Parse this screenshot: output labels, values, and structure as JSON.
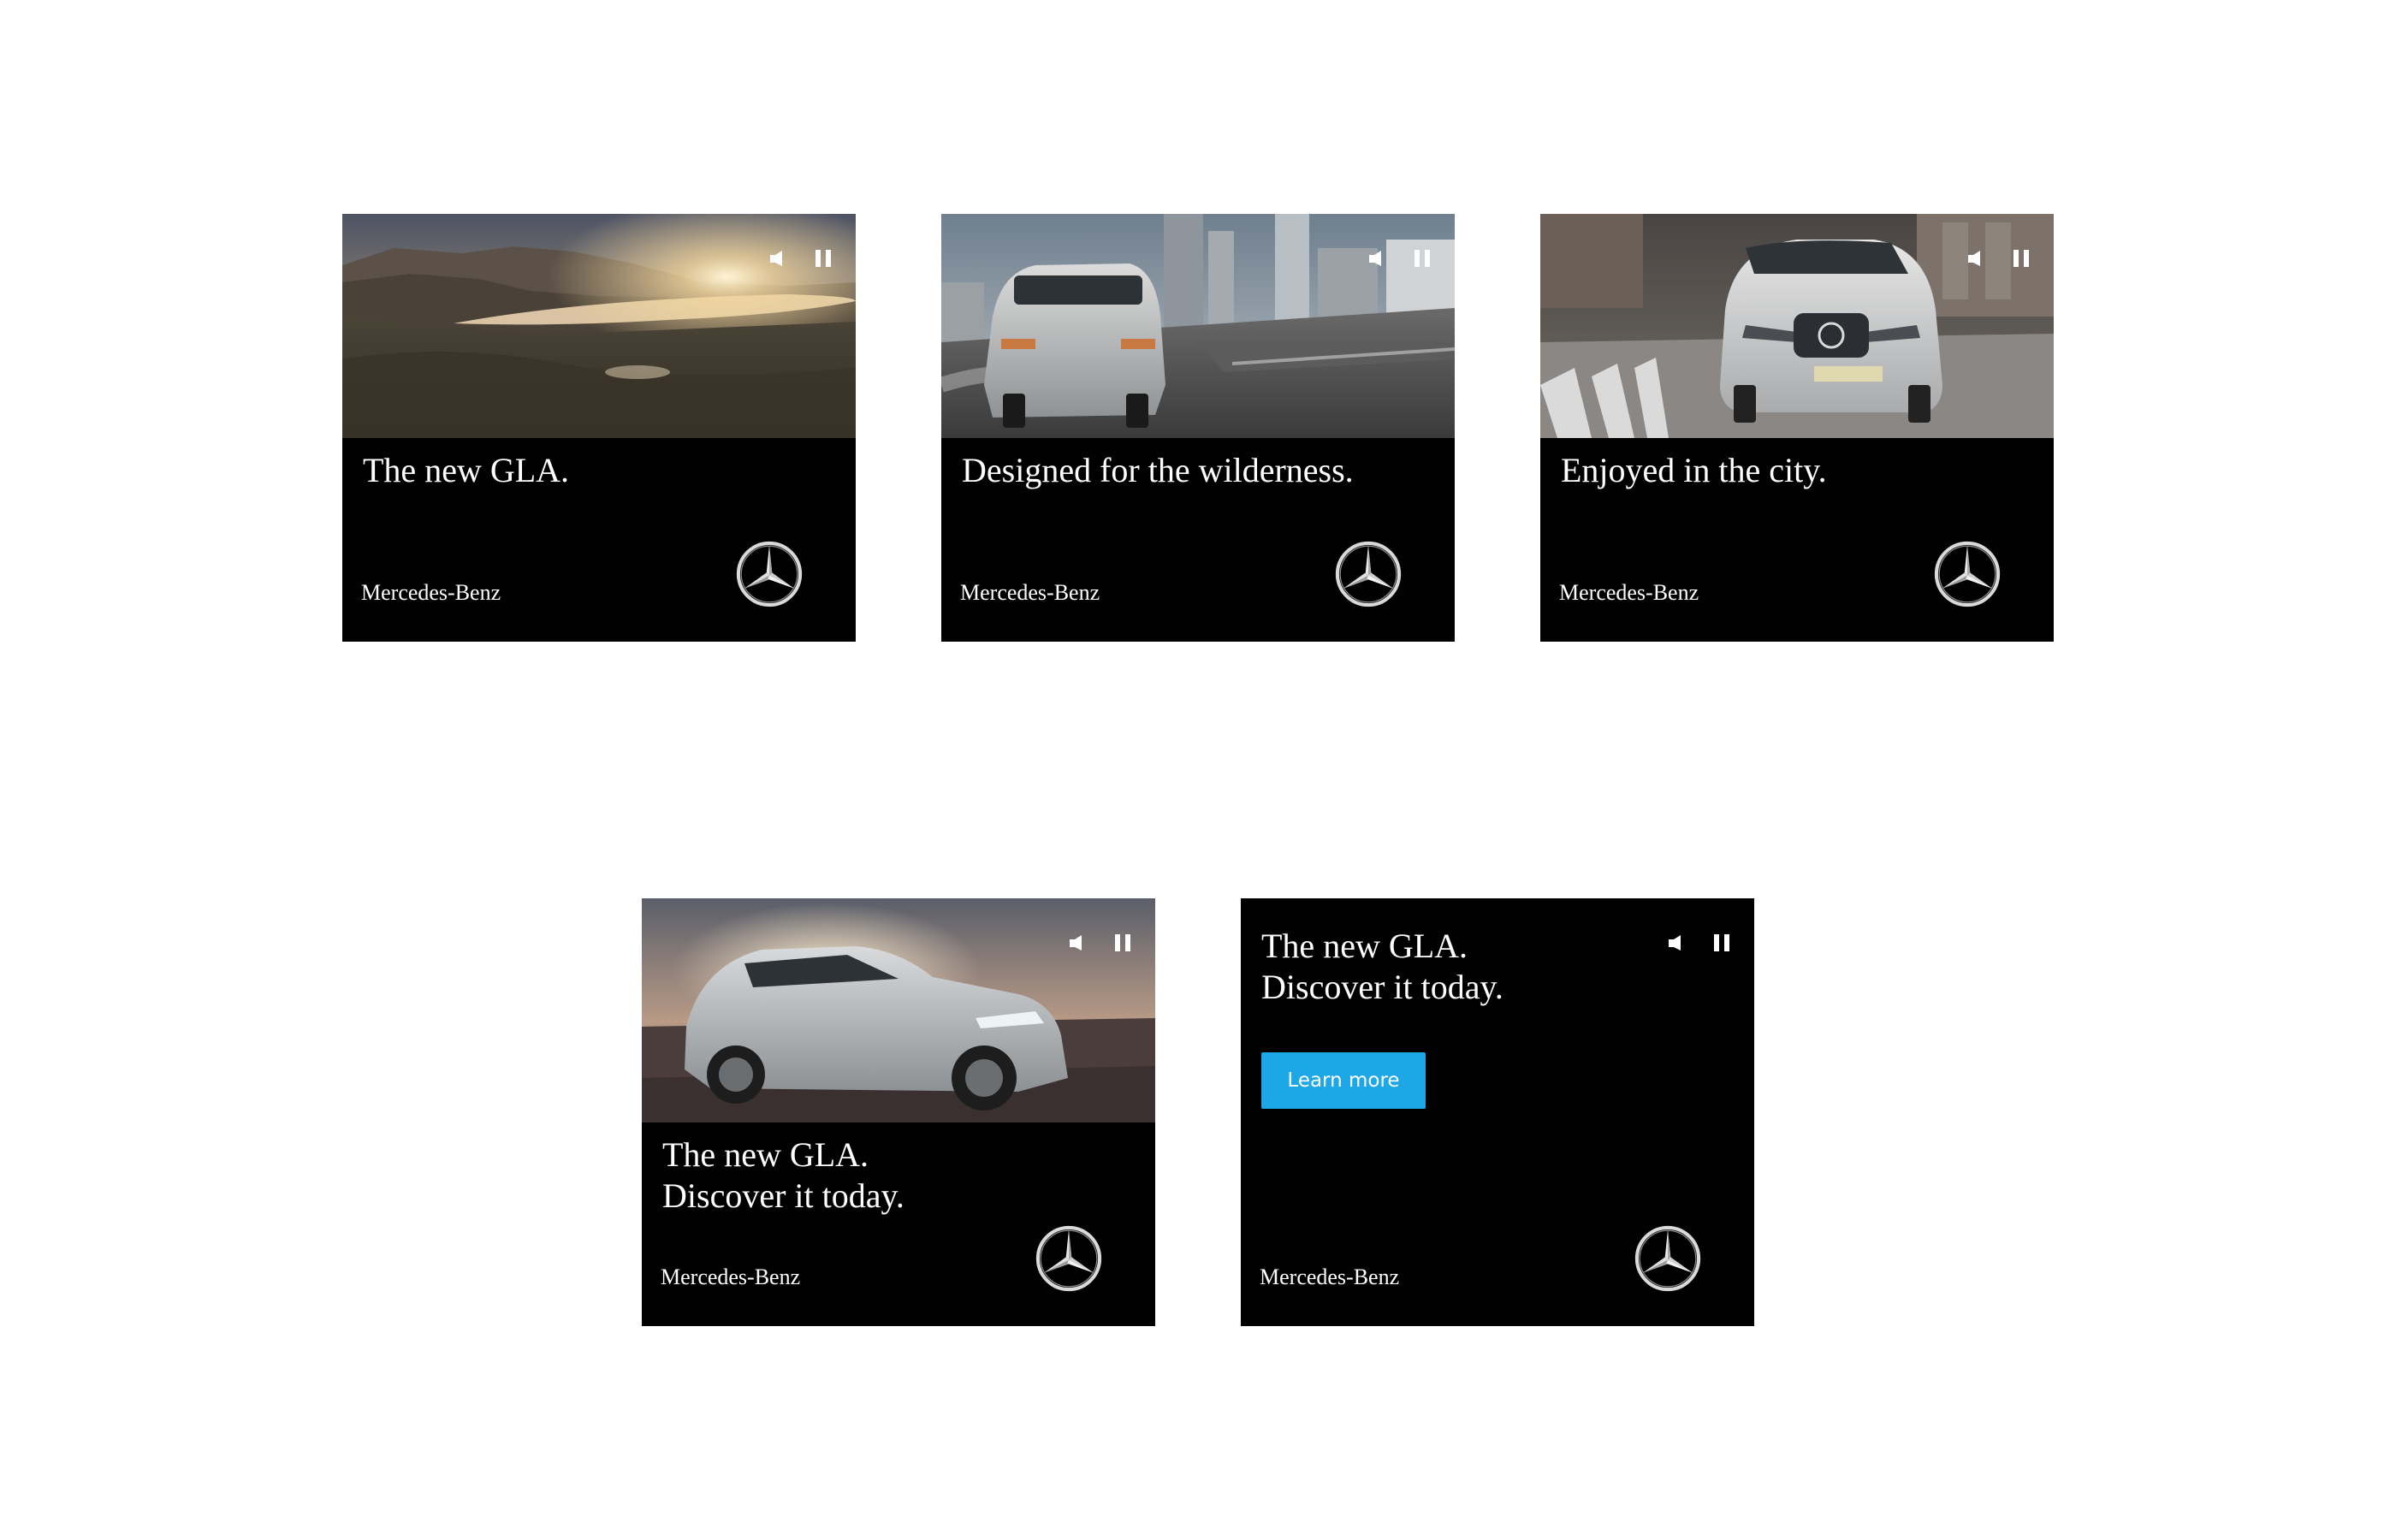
{
  "brand_colors": {
    "cta_blue": "#1ea7e6",
    "ad_background": "#000000",
    "page_background": "#ffffff"
  },
  "icons": {
    "volume": "speaker-icon",
    "pause": "pause-icon",
    "logo": "mercedes-star-logo"
  },
  "ads": [
    {
      "scene": "lake-sunset",
      "headline": [
        "The new GLA."
      ],
      "brand": "Mercedes-Benz"
    },
    {
      "scene": "city-bridge-rear",
      "headline": [
        "Designed for the wilderness."
      ],
      "brand": "Mercedes-Benz"
    },
    {
      "scene": "city-street-front",
      "headline": [
        "Enjoyed in the city."
      ],
      "brand": "Mercedes-Benz"
    },
    {
      "scene": "car-side-sunset",
      "headline": [
        "The new GLA.",
        "Discover it today."
      ],
      "brand": "Mercedes-Benz"
    },
    {
      "scene": "none",
      "headline": [
        "The new GLA.",
        "Discover it today."
      ],
      "cta_label": "Learn more",
      "brand": "Mercedes-Benz"
    }
  ]
}
